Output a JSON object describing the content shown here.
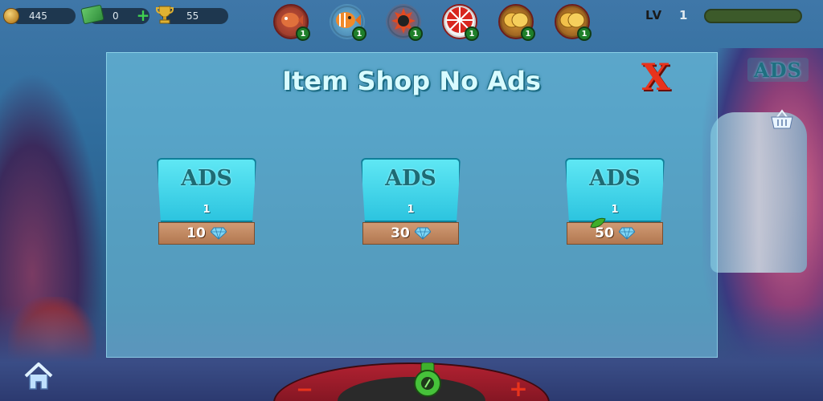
{
  "hud": {
    "coins": "445",
    "cash": "0",
    "trophies": "55",
    "level_label": "LV",
    "level_value": "1",
    "level_progress": 0.0
  },
  "item_slots": [
    {
      "name": "red-fish",
      "count": "1"
    },
    {
      "name": "orange-fish",
      "count": "1"
    },
    {
      "name": "bomb",
      "count": "1"
    },
    {
      "name": "lucky-wheel",
      "count": "1"
    },
    {
      "name": "gold-coins",
      "count": "1"
    },
    {
      "name": "gold-coins-2",
      "count": "1"
    }
  ],
  "corner_ads_label": "ADS",
  "shop": {
    "title": "Item Shop No Ads",
    "close_label": "X",
    "cards": [
      {
        "ads_label": "ADS",
        "quantity": "1",
        "price": "10"
      },
      {
        "ads_label": "ADS",
        "quantity": "1",
        "price": "30"
      },
      {
        "ads_label": "ADS",
        "quantity": "1",
        "price": "50"
      }
    ]
  },
  "controls": {
    "minus_label": "−",
    "plus_label": "+"
  },
  "colors": {
    "panel": "#78d2eb",
    "card_top": "#2cc4df",
    "price_plate": "#b27850",
    "close": "#e8331c",
    "title": "#d8fbff"
  }
}
